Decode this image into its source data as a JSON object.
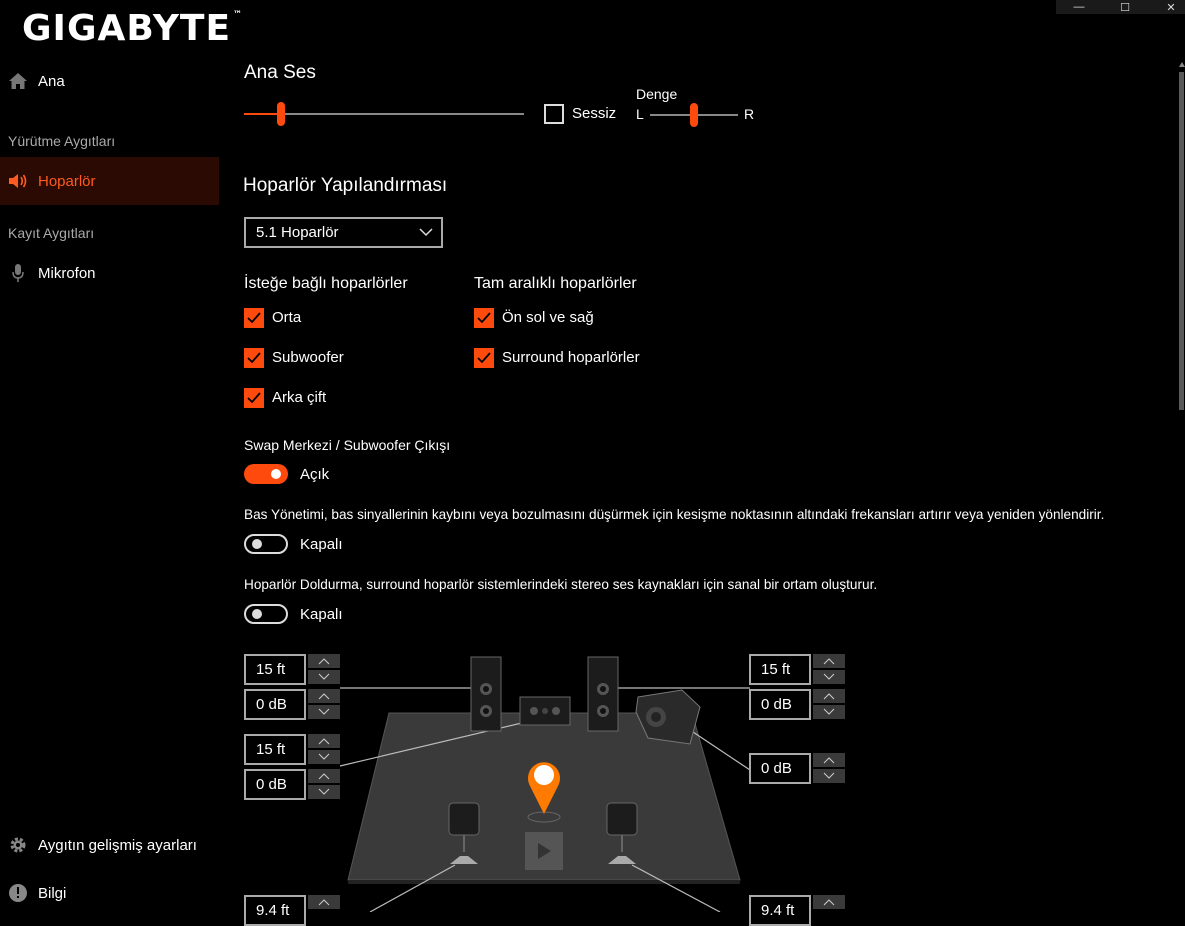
{
  "window": {
    "controls": [
      "—",
      "☐",
      "✕"
    ]
  },
  "brand": {
    "logo_text": "GIGABYTE",
    "tm": "™"
  },
  "sidebar": {
    "home": "Ana",
    "playback_header": "Yürütme Aygıtları",
    "speaker": "Hoparlör",
    "recording_header": "Kayıt Aygıtları",
    "microphone": "Mikrofon",
    "advanced": "Aygıtın gelişmiş ayarları",
    "info": "Bilgi"
  },
  "master": {
    "title": "Ana Ses",
    "volume_level": 0.13,
    "mute_label": "Sessiz",
    "mute_checked": false,
    "balance_label": "Denge",
    "balance_left": "L",
    "balance_right": "R",
    "balance_level": 0.5
  },
  "config": {
    "title": "Hoparlör Yapılandırması",
    "selected": "5.1 Hoparlör"
  },
  "optional": {
    "title": "İsteğe bağlı hoparlörler",
    "items": [
      {
        "label": "Orta",
        "checked": true
      },
      {
        "label": "Subwoofer",
        "checked": true
      },
      {
        "label": "Arka çift",
        "checked": true
      }
    ]
  },
  "fullrange": {
    "title": "Tam aralıklı hoparlörler",
    "items": [
      {
        "label": "Ön sol ve sağ",
        "checked": true
      },
      {
        "label": "Surround hoparlörler",
        "checked": true
      }
    ]
  },
  "swap": {
    "title": "Swap Merkezi / Subwoofer Çıkışı",
    "state": "Açık",
    "on": true
  },
  "bass": {
    "description": "Bas Yönetimi, bas sinyallerinin kaybını veya bozulmasını düşürmek için kesişme noktasının altındaki frekansları artırır veya yeniden yönlendirir.",
    "state": "Kapalı",
    "on": false
  },
  "fill": {
    "description": "Hoparlör Doldurma, surround hoparlör sistemlerindeki stereo ses kaynakları için sanal bir ortam oluşturur.",
    "state": "Kapalı",
    "on": false
  },
  "stage": {
    "front_left_distance": "15 ft",
    "front_left_gain": "0 dB",
    "center_distance": "15 ft",
    "center_gain": "0 dB",
    "front_right_distance": "15 ft",
    "front_right_gain": "0 dB",
    "subwoofer_gain": "0 dB",
    "rear_left_distance": "9.4 ft",
    "rear_right_distance": "9.4 ft"
  },
  "colors": {
    "accent": "#ff4a0e",
    "background": "#000000",
    "active_nav": "#2a0a03"
  }
}
